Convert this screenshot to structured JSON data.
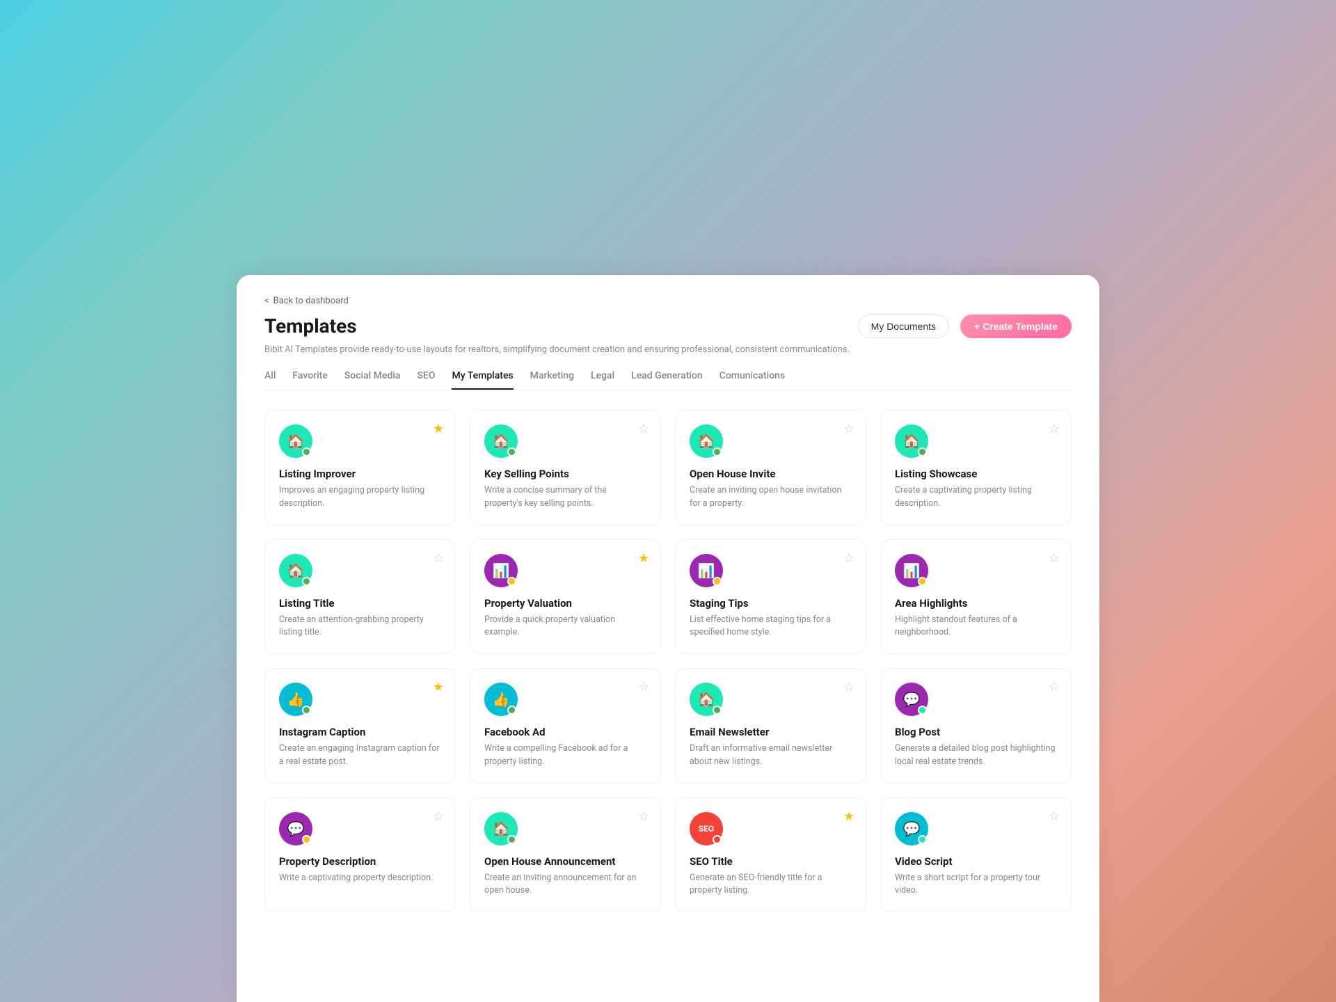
{
  "background": {
    "gradient": "linear-gradient(135deg, #4dd0e1 0%, #80cbc4 20%, #b0aec8 50%, #e8a090 80%, #d4876a 100%)"
  },
  "nav": {
    "back_label": "Back to dashboard"
  },
  "header": {
    "title": "Templates",
    "subtitle": "Bibit AI Templates provide ready-to-use layouts for realtors, simplifying document creation and ensuring professional, consistent communications.",
    "my_documents_label": "My Documents",
    "create_template_label": "+ Create Template"
  },
  "tabs": [
    {
      "id": "all",
      "label": "All",
      "active": false
    },
    {
      "id": "favorite",
      "label": "Favorite",
      "active": false
    },
    {
      "id": "social-media",
      "label": "Social Media",
      "active": false
    },
    {
      "id": "seo",
      "label": "SEO",
      "active": false
    },
    {
      "id": "my-templates",
      "label": "My Templates",
      "active": true
    },
    {
      "id": "marketing",
      "label": "Marketing",
      "active": false
    },
    {
      "id": "legal",
      "label": "Legal",
      "active": false
    },
    {
      "id": "lead-generation",
      "label": "Lead Generation",
      "active": false
    },
    {
      "id": "communications",
      "label": "Comunications",
      "active": false
    }
  ],
  "cards": [
    {
      "id": "listing-improver",
      "title": "Listing Improver",
      "description": "Improves an engaging property listing description.",
      "icon_type": "house",
      "icon_color": "teal",
      "badge_color": "green",
      "starred": true
    },
    {
      "id": "key-selling-points",
      "title": "Key Selling Points",
      "description": "Write a concise summary of the property's key selling points.",
      "icon_type": "house",
      "icon_color": "teal",
      "badge_color": "green",
      "starred": false
    },
    {
      "id": "open-house-invite",
      "title": "Open House Invite",
      "description": "Create an inviting open house invitation for a property.",
      "icon_type": "house",
      "icon_color": "teal",
      "badge_color": "green",
      "starred": false
    },
    {
      "id": "listing-showcase",
      "title": "Listing Showcase",
      "description": "Create a captivating property listing description.",
      "icon_type": "house",
      "icon_color": "teal",
      "badge_color": "green",
      "starred": false
    },
    {
      "id": "listing-title",
      "title": "Listing Title",
      "description": "Create an attention-grabbing property listing title.",
      "icon_type": "house",
      "icon_color": "teal",
      "badge_color": "green",
      "starred": false
    },
    {
      "id": "property-valuation",
      "title": "Property Valuation",
      "description": "Provide a quick property valuation example.",
      "icon_type": "chart",
      "icon_color": "purple",
      "badge_color": "yellow",
      "starred": true
    },
    {
      "id": "staging-tips",
      "title": "Staging Tips",
      "description": "List effective home staging tips for a specified home style.",
      "icon_type": "chart",
      "icon_color": "purple",
      "badge_color": "yellow",
      "starred": false
    },
    {
      "id": "area-highlights",
      "title": "Area Highlights",
      "description": "Highlight standout features of a neighborhood.",
      "icon_type": "chart",
      "icon_color": "purple",
      "badge_color": "yellow",
      "starred": false
    },
    {
      "id": "instagram-caption",
      "title": "Instagram Caption",
      "description": "Create an engaging Instagram caption for a real estate post.",
      "icon_type": "thumb",
      "icon_color": "cyan",
      "badge_color": "green",
      "starred": true
    },
    {
      "id": "facebook-ad",
      "title": "Facebook Ad",
      "description": "Write a compelling Facebook ad for a property listing.",
      "icon_type": "thumb",
      "icon_color": "cyan",
      "badge_color": "green",
      "starred": false
    },
    {
      "id": "email-newsletter",
      "title": "Email Newsletter",
      "description": "Draft an informative email newsletter about new listings.",
      "icon_type": "house",
      "icon_color": "teal",
      "badge_color": "green",
      "starred": false
    },
    {
      "id": "blog-post",
      "title": "Blog Post",
      "description": "Generate a detailed blog post highlighting local real estate trends.",
      "icon_type": "chat",
      "icon_color": "purple",
      "badge_color": "teal",
      "starred": false
    },
    {
      "id": "property-description",
      "title": "Property Description",
      "description": "Write a captivating property description.",
      "icon_type": "chat",
      "icon_color": "purple",
      "badge_color": "yellow",
      "starred": false
    },
    {
      "id": "open-house-announcement",
      "title": "Open House Announcement",
      "description": "Create an inviting announcement for an open house.",
      "icon_type": "house",
      "icon_color": "teal",
      "badge_color": "green",
      "starred": false
    },
    {
      "id": "seo-title",
      "title": "SEO Title",
      "description": "Generate an SEO-friendly title for a property listing.",
      "icon_type": "seo",
      "icon_color": "red",
      "badge_color": "red",
      "starred": true
    },
    {
      "id": "video-script",
      "title": "Video Script",
      "description": "Write a short script for a property tour video.",
      "icon_type": "chat",
      "icon_color": "cyan",
      "badge_color": "teal",
      "starred": false
    }
  ],
  "icons": {
    "house": "🏠",
    "chart": "📊",
    "thumb": "👍",
    "chat": "💬",
    "seo": "SEO"
  }
}
